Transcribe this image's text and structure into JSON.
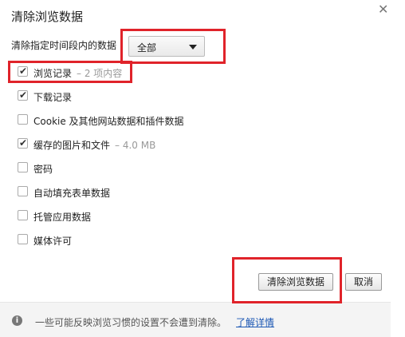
{
  "dialog": {
    "title": "清除浏览数据",
    "close_glyph": "✕"
  },
  "time_range": {
    "label": "清除指定时间段内的数据",
    "selected": "全部"
  },
  "options": [
    {
      "label": "浏览记录",
      "extra": "– 2 项内容",
      "checked": true
    },
    {
      "label": "下载记录",
      "extra": "",
      "checked": true
    },
    {
      "label": "Cookie 及其他网站数据和插件数据",
      "extra": "",
      "checked": false
    },
    {
      "label": "缓存的图片和文件",
      "extra": "– 4.0 MB",
      "checked": true
    },
    {
      "label": "密码",
      "extra": "",
      "checked": false
    },
    {
      "label": "自动填充表单数据",
      "extra": "",
      "checked": false
    },
    {
      "label": "托管应用数据",
      "extra": "",
      "checked": false
    },
    {
      "label": "媒体许可",
      "extra": "",
      "checked": false
    }
  ],
  "buttons": {
    "clear": "清除浏览数据",
    "cancel": "取消"
  },
  "footer": {
    "notice": "一些可能反映浏览习惯的设置不会遭到清除。",
    "learn_more": "了解详情",
    "info_glyph": "i"
  },
  "colors": {
    "highlight": "#e0232a",
    "link": "#1a56b3"
  }
}
